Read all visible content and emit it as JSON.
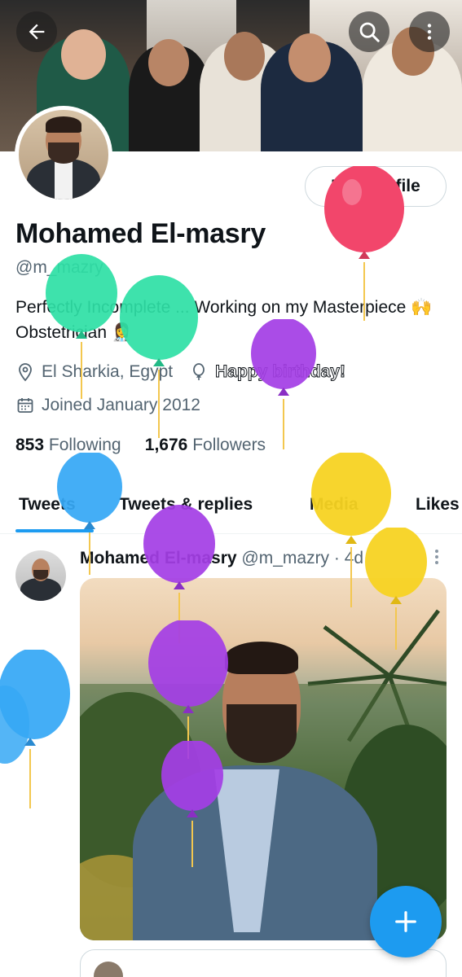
{
  "header": {
    "back_icon": "arrow-left-icon",
    "search_icon": "search-icon",
    "more_icon": "more-vertical-icon"
  },
  "profile": {
    "edit_button": "Edit profile",
    "name": "Mohamed El-masry",
    "handle": "@m_mazry",
    "bio": "Perfectly Incomplete ... Working on my Masterpiece 🙌 Obstetrician 👩‍⚕️",
    "location": "El Sharkia, Egypt",
    "birthday": "Happy birthday!",
    "joined": "Joined January 2012",
    "following_count": "853",
    "following_label": "Following",
    "followers_count": "1,676",
    "followers_label": "Followers"
  },
  "tabs": [
    "Tweets",
    "Tweets & replies",
    "Media",
    "Likes"
  ],
  "tweet": {
    "author": "Mohamed El-masry",
    "handle": "@m_mazry",
    "time": "4d"
  },
  "colors": {
    "accent": "#1d9bf0",
    "text_secondary": "#536471",
    "balloon_red": "#f2466b",
    "balloon_green": "#2ee0a5",
    "balloon_purple": "#a43ee5",
    "balloon_blue": "#36a8f5",
    "balloon_yellow": "#f7d322"
  }
}
